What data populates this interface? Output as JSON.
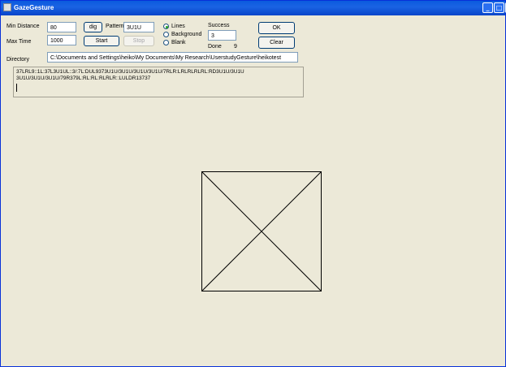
{
  "window": {
    "title": "GazeGesture",
    "controls": {
      "minimize": "_",
      "maximize": "□",
      "close": "×"
    }
  },
  "form": {
    "min_distance_label": "Min Distance",
    "min_distance_value": "80",
    "max_time_label": "Max Time",
    "max_time_value": "1000",
    "directory_label": "Directory",
    "directory_value": "C:\\Documents and Settings\\heiko\\My Documents\\My Research\\UserstudyGesture\\heikotest",
    "pattern_label": "Pattern",
    "pattern_value": "3U1U",
    "dig_button": "dig",
    "start_button": "Start",
    "stop_button": "Stop",
    "mode_options": [
      "Lines",
      "Background",
      "Blank"
    ],
    "mode_selected": "Lines",
    "success_label": "Success",
    "success_value": "3",
    "done_label": "Done",
    "done_value": "9",
    "ok_button": "OK",
    "clear_button": "Clear"
  },
  "log": {
    "line1": "37LRL9::1L:37L3U1UL::3/:7L:DUL9373U1U/3U1U/3U1U/3U1U/7RLR:LRLRLRLRL:RD3U1U/3U1U",
    "line2": "3U1U/3U1U/3U1U/79R379L:RL:RL:RLRLR::LULDR13737"
  },
  "canvas": {
    "figure": "square-with-diagonals"
  }
}
